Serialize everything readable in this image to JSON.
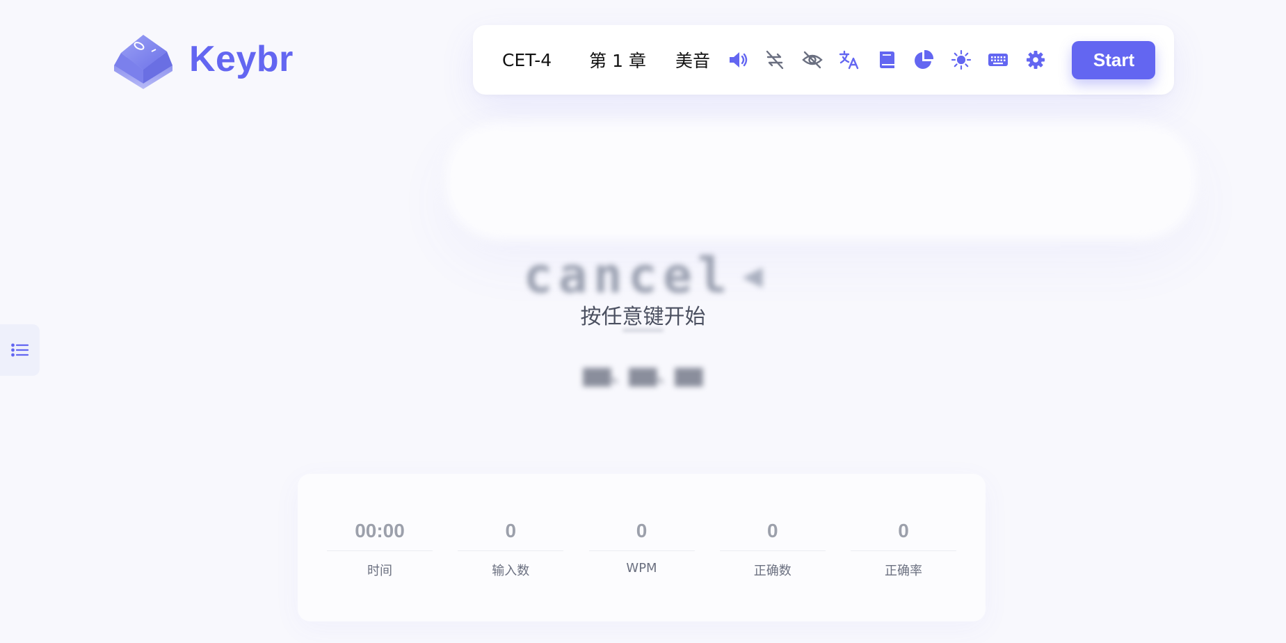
{
  "brand": {
    "name": "Keybr"
  },
  "toolbar": {
    "dictionary": "CET-4",
    "chapter": "第 1 章",
    "accent": "美音",
    "icons": [
      "sound-icon",
      "loop-off-icon",
      "eye-off-icon",
      "translate-icon",
      "book-icon",
      "pie-chart-icon",
      "sun-icon",
      "keyboard-icon",
      "gear-icon"
    ],
    "start_label": "Start",
    "accent_color": "#6366f1"
  },
  "word": {
    "text": "cancel"
  },
  "hint": "按任意键开始",
  "stats": [
    {
      "value": "00:00",
      "label": "时间"
    },
    {
      "value": "0",
      "label": "输入数"
    },
    {
      "value": "0",
      "label": "WPM"
    },
    {
      "value": "0",
      "label": "正确数"
    },
    {
      "value": "0",
      "label": "正确率"
    }
  ]
}
